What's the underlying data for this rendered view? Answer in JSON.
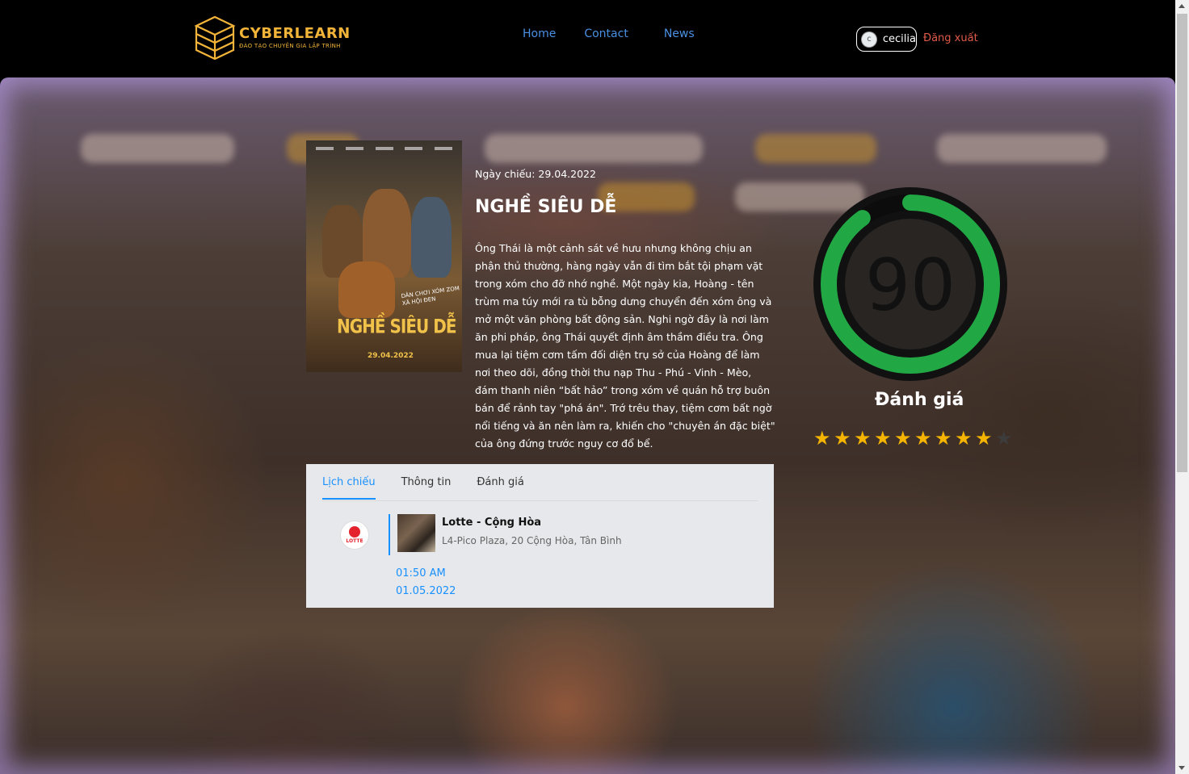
{
  "header": {
    "brand": "CYBERLEARN",
    "tagline": "ĐÀO TẠO CHUYÊN GIA LẬP TRÌNH",
    "nav": [
      "Home",
      "Contact",
      "News"
    ],
    "user": {
      "avatar_letter": "c",
      "name": "cecilia"
    },
    "logout_label": "Đăng xuất"
  },
  "movie": {
    "release_label": "Ngày chiếu: 29.04.2022",
    "title": "NGHỀ SIÊU DỄ",
    "poster": {
      "title": "NGHỀ SIÊU DỄ",
      "date": "29.04.2022",
      "tagline": "DÂN CHƠI XÓM ZOM XÃ HỘI ĐEN"
    },
    "description": "Ông Thái là một cảnh sát về hưu nhưng không chịu an phận thủ thường, hàng ngày vẫn đi tìm bắt tội phạm vặt trong xóm cho đỡ nhớ nghề. Một ngày kia, Hoàng - tên trùm ma túy mới ra tù bỗng dưng chuyển đến xóm ông và mở một văn phòng bất động sản. Nghi ngờ đây là nơi làm ăn phi pháp, ông Thái quyết định âm thầm điều tra. Ông mua lại tiệm cơm tấm đối diện trụ sở của Hoàng để làm nơi theo dõi, đồng thời thu nạp Thu - Phú - Vinh - Mèo, đám thanh niên “bất hảo” trong xóm về quán hỗ trợ buôn bán để rảnh tay \"phá án\". Trớ trêu thay, tiệm cơm bất ngờ nổi tiếng và ăn nên làm ra, khiến cho \"chuyên án đặc biệt\" của ông đứng trước nguy cơ đổ bể."
  },
  "rating": {
    "score": "90",
    "percent": 90,
    "label": "Đánh giá",
    "stars_filled": 9,
    "stars_total": 10,
    "ring_color": "#22a745"
  },
  "tabs": {
    "items": [
      "Lịch chiếu",
      "Thông tin",
      "Đánh giá"
    ],
    "active": "Lịch chiếu"
  },
  "schedule": {
    "cinema_logo": "LOTTE",
    "theater_name": "Lotte - Cộng Hòa",
    "theater_address": "L4-Pico Plaza, 20 Cộng Hòa, Tân Bình",
    "time": "01:50 AM",
    "date": "01.05.2022"
  },
  "colors": {
    "accent": "#1890ff",
    "brand": "#f2b438",
    "logout": "#e05a4a",
    "star": "#f5b400"
  }
}
